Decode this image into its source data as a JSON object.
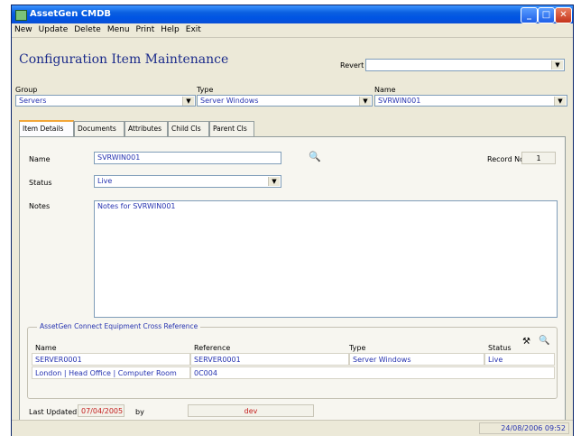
{
  "window": {
    "title": "AssetGen CMDB"
  },
  "menu": [
    "New",
    "Update",
    "Delete",
    "Menu",
    "Print",
    "Help",
    "Exit"
  ],
  "heading": "Configuration Item Maintenance",
  "revert": {
    "label": "Revert",
    "value": ""
  },
  "group": {
    "label": "Group",
    "value": "Servers"
  },
  "type": {
    "label": "Type",
    "value": "Server Windows"
  },
  "name_select": {
    "label": "Name",
    "value": "SVRWIN001"
  },
  "tabs": [
    "Item Details",
    "Documents",
    "Attributes",
    "Child CIs",
    "Parent CIs"
  ],
  "form": {
    "name_label": "Name",
    "name_value": "SVRWIN001",
    "record_label": "Record No:",
    "record_value": "1",
    "status_label": "Status",
    "status_value": "Live",
    "notes_label": "Notes",
    "notes_value": "Notes for SVRWIN001"
  },
  "crossref": {
    "title": "AssetGen Connect Equipment Cross Reference",
    "headers": {
      "name": "Name",
      "reference": "Reference",
      "type": "Type",
      "status": "Status"
    },
    "row": {
      "name": "SERVER0001",
      "reference": "SERVER0001",
      "type": "Server Windows",
      "status": "Live"
    },
    "location": "London | Head Office | Computer Room",
    "location_code": "0C004"
  },
  "footer": {
    "last_updated_label": "Last Updated",
    "last_updated_value": "07/04/2005",
    "by_label": "by",
    "by_value": "dev"
  },
  "status": {
    "datetime": "24/08/2006 09:52"
  }
}
